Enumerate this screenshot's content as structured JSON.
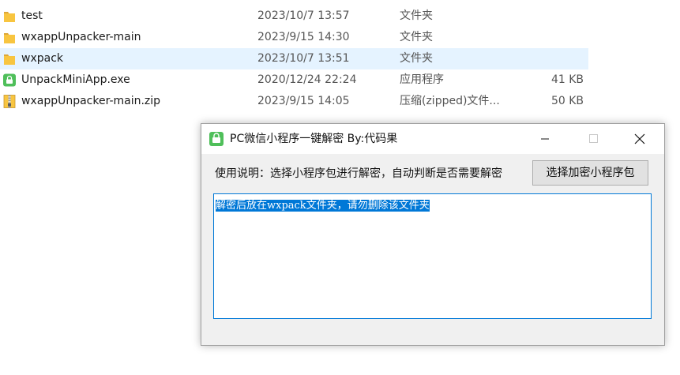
{
  "files": [
    {
      "name": "test",
      "modified": "2023/10/7 13:57",
      "type": "文件夹",
      "size": "",
      "icon": "folder-icon",
      "selected": false
    },
    {
      "name": "wxappUnpacker-main",
      "modified": "2023/9/15 14:30",
      "type": "文件夹",
      "size": "",
      "icon": "folder-icon",
      "selected": false
    },
    {
      "name": "wxpack",
      "modified": "2023/10/7 13:51",
      "type": "文件夹",
      "size": "",
      "icon": "folder-icon",
      "selected": true
    },
    {
      "name": "UnpackMiniApp.exe",
      "modified": "2020/12/24 22:24",
      "type": "应用程序",
      "size": "41 KB",
      "icon": "exe-app-icon",
      "selected": false
    },
    {
      "name": "wxappUnpacker-main.zip",
      "modified": "2023/9/15 14:05",
      "type": "压缩(zipped)文件...",
      "size": "50 KB",
      "icon": "zip-archive-icon",
      "selected": false
    }
  ],
  "dialog": {
    "title": "PC微信小程序一键解密 By:代码果",
    "instruction": "使用说明：选择小程序包进行解密，自动判断是否需要解密",
    "select_button": "选择加密小程序包",
    "output_text": "解密后放在wxpack文件夹，请勿删除该文件夹"
  },
  "colors": {
    "folder": "#f8c540",
    "app_green": "#4fbf5a",
    "selection": "#e5f3ff",
    "accent": "#0078d7"
  }
}
